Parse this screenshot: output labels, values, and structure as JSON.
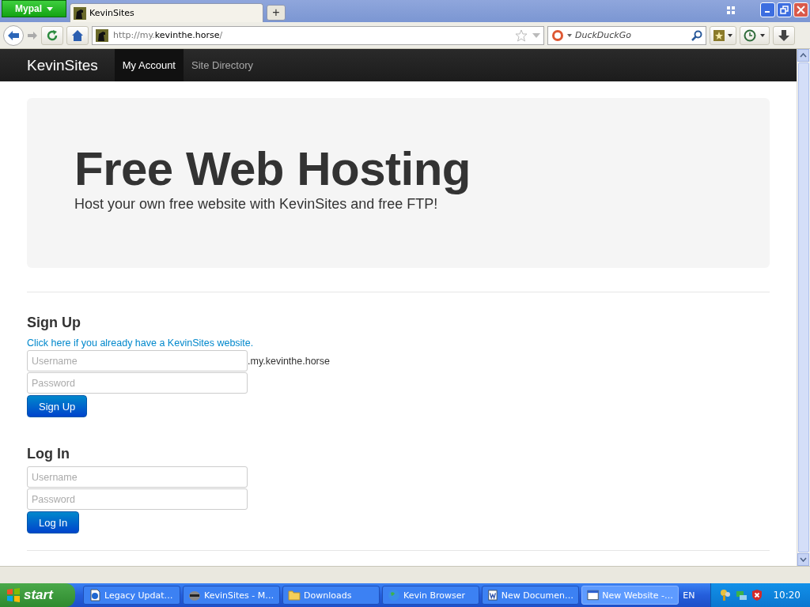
{
  "browser": {
    "menu_button": "Mypal",
    "tabs": [
      {
        "title": "KevinSites",
        "selected": true
      }
    ],
    "new_tab": "+",
    "url": {
      "prefix": "http://my.",
      "domain": "kevinthe.horse",
      "suffix": "/"
    },
    "search": {
      "placeholder": "DuckDuckGo"
    }
  },
  "site": {
    "brand": "KevinSites",
    "nav": [
      {
        "label": "My Account",
        "selected": true
      },
      {
        "label": "Site Directory",
        "selected": false
      }
    ],
    "hero": {
      "title": "Free Web Hosting",
      "subtitle": "Host your own free website with KevinSites and free FTP!"
    },
    "signup": {
      "heading": "Sign Up",
      "link": "Click here if you already have a KevinSites website.",
      "username": {
        "placeholder": "Username"
      },
      "domain_suffix": ".my.kevinthe.horse",
      "password": {
        "placeholder": "Password"
      },
      "button": "Sign Up"
    },
    "login": {
      "heading": "Log In",
      "username": {
        "placeholder": "Username"
      },
      "password": {
        "placeholder": "Password"
      },
      "button": "Log In"
    }
  },
  "taskbar": {
    "start": "start",
    "items": [
      {
        "label": "Legacy Updat…",
        "kind": "document",
        "selected": false
      },
      {
        "label": "KevinSites - M…",
        "kind": "animal",
        "selected": false
      },
      {
        "label": "Downloads",
        "kind": "folder",
        "selected": false
      },
      {
        "label": "Kevin Browser",
        "kind": "globe",
        "selected": false
      },
      {
        "label": "New Documen…",
        "kind": "word",
        "selected": false
      },
      {
        "label": "New Website -…",
        "kind": "window",
        "selected": true
      }
    ],
    "language": "EN",
    "clock": "10:20"
  }
}
